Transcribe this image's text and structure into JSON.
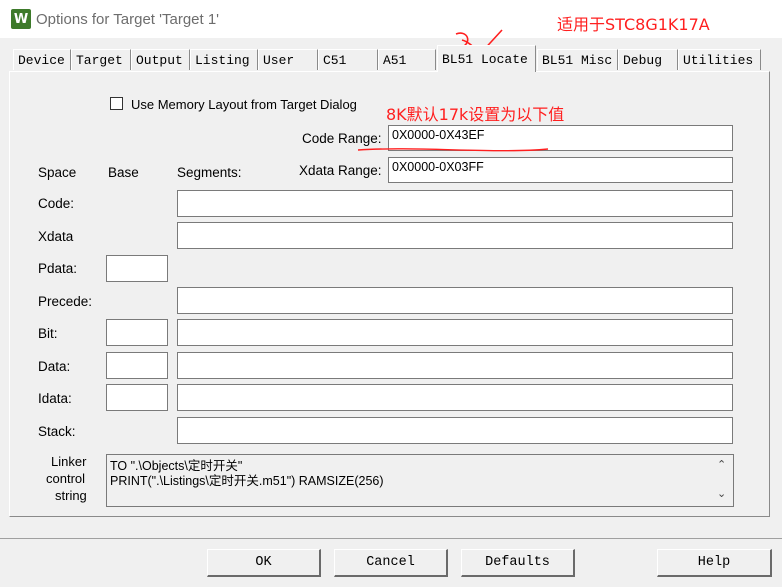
{
  "window": {
    "title": "Options for Target 'Target 1'",
    "app_icon_letter": "W"
  },
  "annotations": {
    "top_right": "适用于STC8G1K17A",
    "code_range_note": "8K默认17k设置为以下值",
    "color": "#ff1f1f"
  },
  "tabs": [
    "Device",
    "Target",
    "Output",
    "Listing",
    "User",
    "C51",
    "A51",
    "BL51 Locate",
    "BL51 Misc",
    "Debug",
    "Utilities"
  ],
  "active_tab": "BL51 Locate",
  "form": {
    "use_memory_layout_label": "Use Memory Layout from Target Dialog",
    "use_memory_layout_checked": false,
    "code_range_label": "Code Range:",
    "code_range_value": "0X0000-0X43EF",
    "xdata_range_label": "Xdata Range:",
    "xdata_range_value": "0X0000-0X03FF",
    "col_space": "Space",
    "col_base": "Base",
    "col_segments": "Segments:",
    "rows": {
      "code": "Code:",
      "xdata": "Xdata",
      "pdata": "Pdata:",
      "precede": "Precede:",
      "bit": "Bit:",
      "data": "Data:",
      "idata": "Idata:",
      "stack": "Stack:"
    },
    "linker_label_1": "Linker",
    "linker_label_2": "control",
    "linker_label_3": "string",
    "linker_line_1": "TO \".\\Objects\\定时开关\"",
    "linker_line_2": "PRINT(\".\\Listings\\定时开关.m51\") RAMSIZE(256)"
  },
  "buttons": {
    "ok": "OK",
    "cancel": "Cancel",
    "defaults": "Defaults",
    "help": "Help"
  }
}
